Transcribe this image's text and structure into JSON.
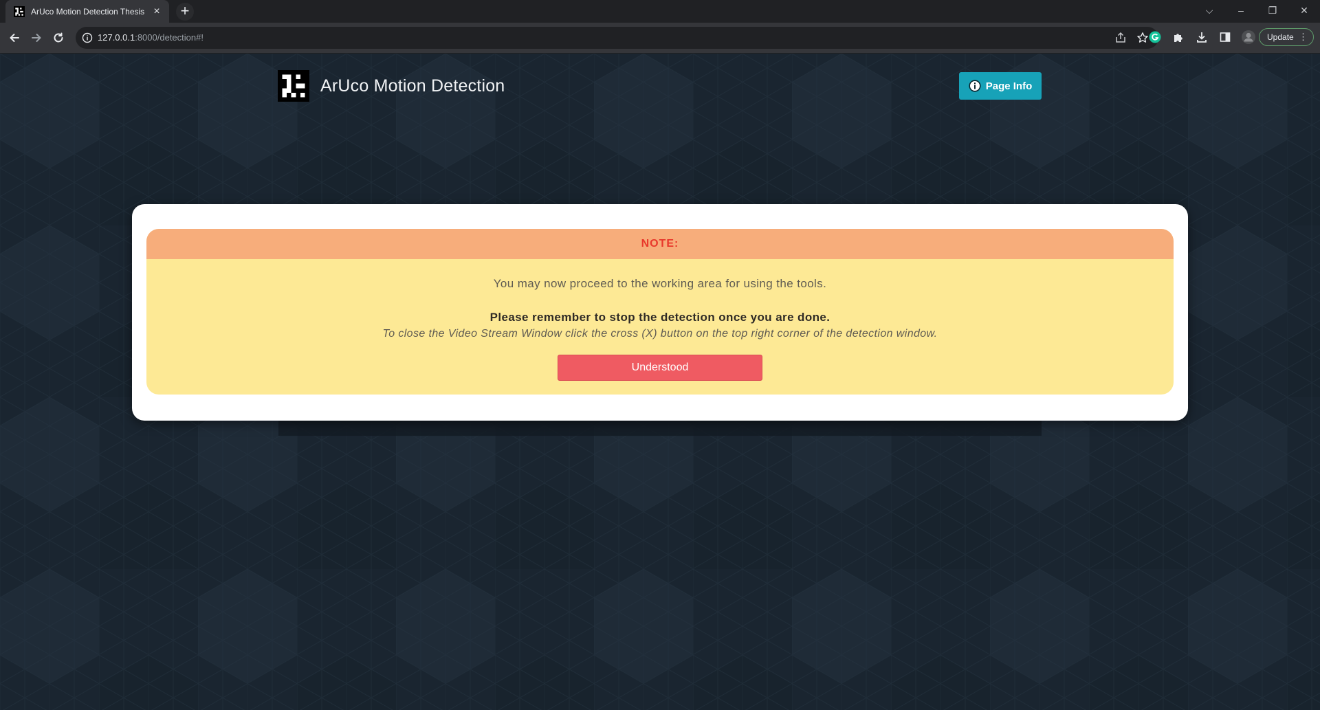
{
  "browser": {
    "tab_title": "ArUco Motion Detection Thesis",
    "tab_close": "×",
    "new_tab": "+",
    "url_host": "127.0.0.1",
    "url_rest": ":8000/detection#!",
    "update_label": "Update",
    "window_controls": [
      "⌵",
      "–",
      "❐",
      "✕"
    ]
  },
  "header": {
    "title": "ArUco Motion Detection",
    "page_info_label": "Page Info"
  },
  "modal": {
    "note_title": "NOTE:",
    "line1": "You may now proceed to the working area for using the tools.",
    "line2": "Please remember to stop the detection once you are done.",
    "line3": "To close the Video Stream Window click the cross (X) button on the top right corner of the detection window.",
    "button_label": "Understood"
  },
  "colors": {
    "page_bg": "#1a2530",
    "info_button": "#17a2b8",
    "note_header_bg": "#f7ad7b",
    "note_header_text": "#e8382b",
    "note_body_bg": "#fde995",
    "understood_button": "#ef5b62",
    "update_border": "#5e9b6a"
  }
}
